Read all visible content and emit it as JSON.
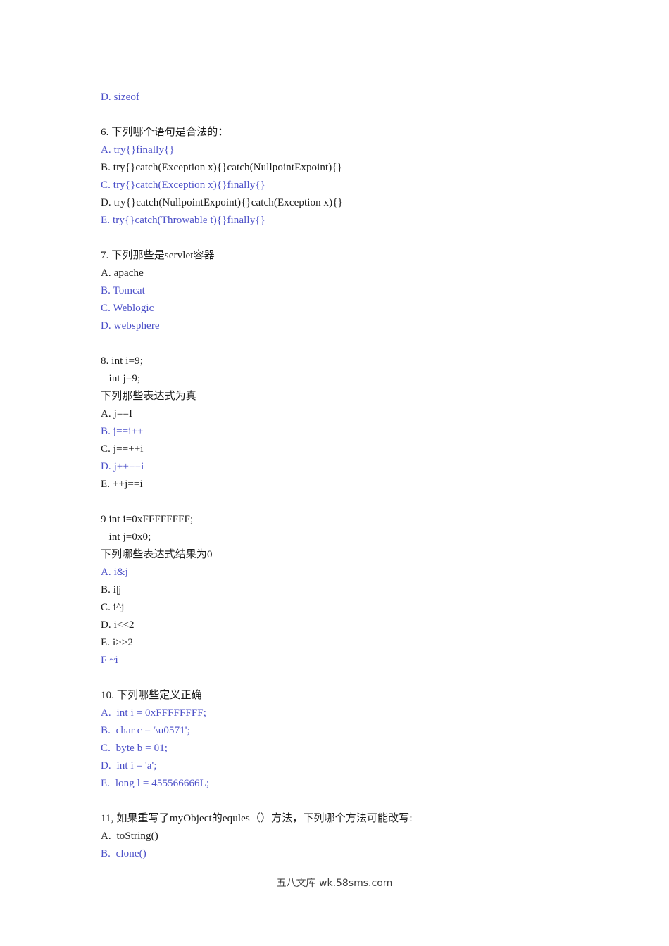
{
  "document": {
    "lines": [
      {
        "text": "D. sizeof",
        "color": "blue"
      },
      {
        "text": "",
        "color": "gap"
      },
      {
        "text": "6. 下列哪个语句是合法的：",
        "color": "black"
      },
      {
        "text": "A. try{}finally{}",
        "color": "blue"
      },
      {
        "text": "B. try{}catch(Exception x){}catch(NullpointExpoint){}",
        "color": "black"
      },
      {
        "text": "C. try{}catch(Exception x){}finally{}",
        "color": "blue"
      },
      {
        "text": "D. try{}catch(NullpointExpoint){}catch(Exception x){}",
        "color": "black"
      },
      {
        "text": "E. try{}catch(Throwable t){}finally{}",
        "color": "blue"
      },
      {
        "text": "",
        "color": "gap"
      },
      {
        "text": "7. 下列那些是servlet容器",
        "color": "black"
      },
      {
        "text": "A. apache",
        "color": "black"
      },
      {
        "text": "B. Tomcat",
        "color": "blue"
      },
      {
        "text": "C. Weblogic",
        "color": "blue"
      },
      {
        "text": "D. websphere",
        "color": "blue"
      },
      {
        "text": "",
        "color": "gap"
      },
      {
        "text": "8. int i=9;",
        "color": "black"
      },
      {
        "text": "   int j=9;",
        "color": "black"
      },
      {
        "text": "下列那些表达式为真",
        "color": "black"
      },
      {
        "text": "A. j==I",
        "color": "black"
      },
      {
        "text": "B. j==i++",
        "color": "blue"
      },
      {
        "text": "C. j==++i",
        "color": "black"
      },
      {
        "text": "D. j++==i",
        "color": "blue"
      },
      {
        "text": "E. ++j==i",
        "color": "black"
      },
      {
        "text": "",
        "color": "gap"
      },
      {
        "text": "9 int i=0xFFFFFFFF;",
        "color": "black"
      },
      {
        "text": "   int j=0x0;",
        "color": "black"
      },
      {
        "text": "下列哪些表达式结果为0",
        "color": "black"
      },
      {
        "text": "A. i&j",
        "color": "blue"
      },
      {
        "text": "B. i|j",
        "color": "black"
      },
      {
        "text": "C. i^j",
        "color": "black"
      },
      {
        "text": "D. i<<2",
        "color": "black"
      },
      {
        "text": "E. i>>2",
        "color": "black"
      },
      {
        "text": "F ~i",
        "color": "blue"
      },
      {
        "text": "",
        "color": "gap"
      },
      {
        "text": "10. 下列哪些定义正确",
        "color": "black"
      },
      {
        "text": "A.  int i = 0xFFFFFFFF;",
        "color": "blue"
      },
      {
        "text": "B.  char c = '\\u0571';",
        "color": "blue"
      },
      {
        "text": "C.  byte b = 01;",
        "color": "blue"
      },
      {
        "text": "D.  int i = 'a';",
        "color": "blue"
      },
      {
        "text": "E.  long l = 455566666L;",
        "color": "blue"
      },
      {
        "text": "",
        "color": "gap"
      },
      {
        "text": "11, 如果重写了myObject的equles（）方法，下列哪个方法可能改写:",
        "color": "black"
      },
      {
        "text": "A.  toString()",
        "color": "black"
      },
      {
        "text": "B.  clone()",
        "color": "blue"
      }
    ]
  },
  "footer": {
    "watermark": "五八文库 wk.58sms.com"
  },
  "colors": {
    "text": "#1a1a1a",
    "highlight_blue": "#4b4fc8",
    "page_background": "#ffffff"
  }
}
